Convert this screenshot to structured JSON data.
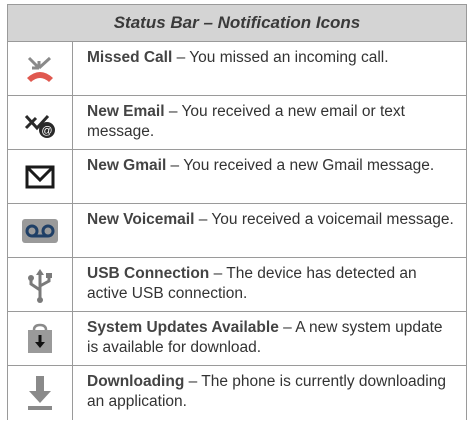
{
  "header": "Status Bar – Notification Icons",
  "sep": " – ",
  "rows": [
    {
      "icon": "missed-call-icon",
      "title": "Missed Call",
      "desc": "You missed an incoming call."
    },
    {
      "icon": "new-email-icon",
      "title": "New Email",
      "desc": "You received a new email or text message."
    },
    {
      "icon": "gmail-icon",
      "title": "New Gmail",
      "desc": "You received a new Gmail message."
    },
    {
      "icon": "voicemail-icon",
      "title": "New Voicemail",
      "desc": "You received a voicemail message."
    },
    {
      "icon": "usb-icon",
      "title": "USB Connection",
      "desc": "The device has detected an active USB connection."
    },
    {
      "icon": "system-update-icon",
      "title": "System Updates Available",
      "desc": "A new system update is available for download."
    },
    {
      "icon": "download-icon",
      "title": "Downloading",
      "desc": "The phone is currently downloading an application."
    }
  ]
}
